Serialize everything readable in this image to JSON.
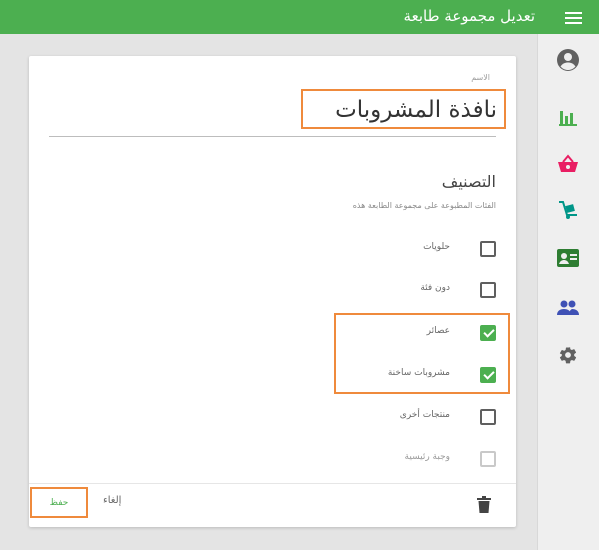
{
  "appbar": {
    "title": "تعديل مجموعة طابعة",
    "menu_icon": "menu-icon",
    "background": "#4caf50"
  },
  "rail": {
    "items": [
      {
        "icon": "account-circle-icon",
        "color": "#616161"
      },
      {
        "icon": "bar-chart-icon",
        "color": "#4caf50"
      },
      {
        "icon": "shopping-basket-icon",
        "color": "#e91e63"
      },
      {
        "icon": "hand-truck-icon",
        "color": "#009688"
      },
      {
        "icon": "contact-card-icon",
        "color": "#2e7d32"
      },
      {
        "icon": "people-icon",
        "color": "#3f51b5"
      },
      {
        "icon": "settings-gear-icon",
        "color": "#616161"
      }
    ]
  },
  "form": {
    "name_label": "الاسم",
    "name_value": "نافذة المشروبات",
    "category_title": "التصنيف",
    "category_subtitle": "الفئات المطبوعة على مجموعة الطابعة هذه",
    "categories": [
      {
        "label": "حلويات",
        "checked": false,
        "disabled": false
      },
      {
        "label": "دون فئة",
        "checked": false,
        "disabled": false
      },
      {
        "label": "عصائر",
        "checked": true,
        "disabled": false
      },
      {
        "label": "مشروبات ساخنة",
        "checked": true,
        "disabled": false
      },
      {
        "label": "منتجات أخرى",
        "checked": false,
        "disabled": false
      },
      {
        "label": "وجبة رئيسية",
        "checked": false,
        "disabled": true
      }
    ]
  },
  "footer": {
    "save_label": "حفظ",
    "cancel_label": "إلغاء",
    "delete_icon": "trash-icon"
  },
  "colors": {
    "accent": "#4caf50",
    "highlight": "#ef8a3c"
  }
}
